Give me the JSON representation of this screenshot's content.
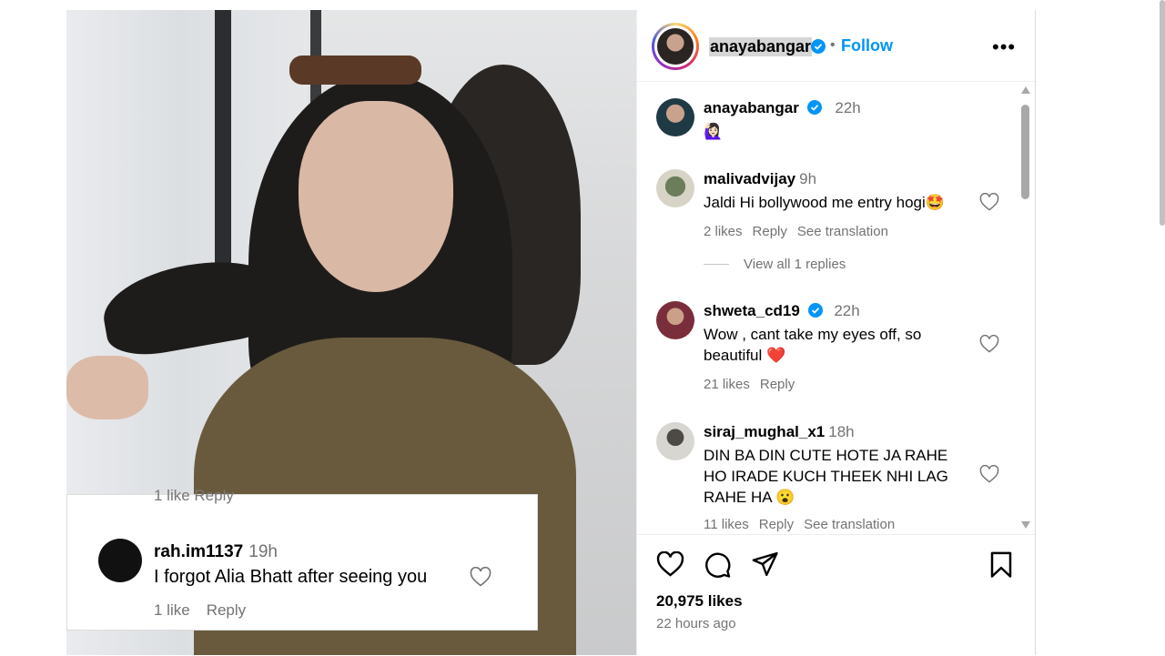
{
  "post_header": {
    "username": "anayabangar",
    "separator": "•",
    "follow_label": "Follow",
    "more_label": "•••"
  },
  "caption": {
    "username": "anayabangar",
    "time": "22h",
    "text": "🙋🏻‍♀️"
  },
  "comments": [
    {
      "username": "malivadvijay",
      "time": "9h",
      "text": "Jaldi Hi bollywood me entry hogi🤩",
      "likes": "2 likes",
      "reply": "Reply",
      "translation": "See translation",
      "view_replies": "View all 1 replies"
    },
    {
      "username": "shweta_cd19",
      "time": "22h",
      "text": "Wow , cant take my eyes off, so beautiful ❤️",
      "likes": "21 likes",
      "reply": "Reply"
    },
    {
      "username": "siraj_mughal_x1",
      "time": "18h",
      "text": "DIN BA DIN CUTE HOTE JA RAHE HO IRADE KUCH THEEK NHI LAG RAHE HA 😮",
      "likes": "11 likes",
      "reply": "Reply",
      "translation": "See translation"
    }
  ],
  "overlay_comment": {
    "cut_meta": "1 like   Reply",
    "username": "rah.im1137",
    "time": "19h",
    "text": "I forgot Alia Bhatt after seeing you",
    "likes": "1 like",
    "reply": "Reply"
  },
  "footer": {
    "likes": "20,975 likes",
    "time_ago": "22 hours ago"
  },
  "colors": {
    "accent": "#0095f6",
    "muted": "#737373",
    "verified": "#0095f6"
  },
  "icons": [
    "verified-badge-icon",
    "heart-icon",
    "comment-icon",
    "share-icon",
    "bookmark-icon",
    "more-icon"
  ]
}
